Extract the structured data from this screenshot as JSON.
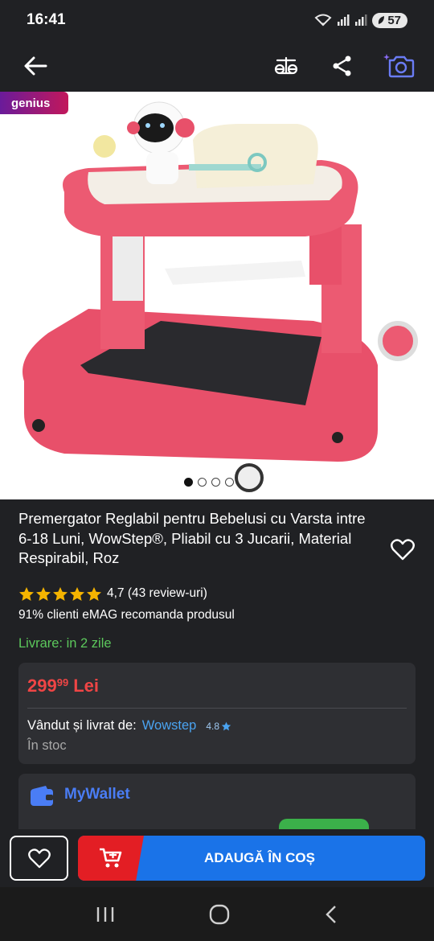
{
  "status_bar": {
    "time": "16:41",
    "battery": "57"
  },
  "nav": {
    "back_icon": "back-arrow-icon",
    "compare_icon": "compare-scale-icon",
    "share_icon": "share-icon",
    "camera_icon": "camera-search-icon"
  },
  "gallery": {
    "badge": "genius",
    "total_images": 4,
    "active_index": 0
  },
  "product": {
    "title": "Premergator Reglabil pentru Bebelusi cu Varsta intre 6-18 Luni, WowStep®, Pliabil cu 3 Jucarii, Material Respirabil, Roz",
    "rating": 5,
    "rating_text": "4,7 (43 review-uri)",
    "recommend": "91% clienti eMAG recomanda produsul",
    "delivery": "Livrare: in 2 zile"
  },
  "price_card": {
    "price_main": "299",
    "price_cents": "99",
    "currency": "Lei",
    "seller_label": "Vândut și livrat de:",
    "seller_name": "Wowstep",
    "seller_score": "4.8",
    "stock": "În stoc"
  },
  "wallet": {
    "label": "MyWallet"
  },
  "actions": {
    "add_to_cart": "ADAUGĂ ÎN COȘ"
  },
  "colors": {
    "accent_blue": "#1a73e8",
    "accent_red": "#e31e24",
    "price_red": "#ef4545",
    "delivery_green": "#5cc85c",
    "star": "#f5b400"
  }
}
